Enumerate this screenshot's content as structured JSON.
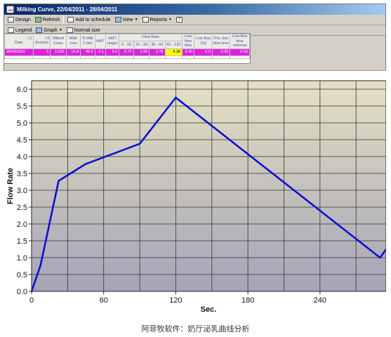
{
  "window": {
    "title": "Milking Curve, 22/04/2011 - 28/04/2011"
  },
  "toolbar": {
    "design": "Design",
    "refresh": "Refresh",
    "add_to_schedule": "Add to schedule",
    "view": "View",
    "reports": "Reports"
  },
  "toolbar2": {
    "legend": "Legend",
    "graph": "Graph",
    "normal_size": "Normal size"
  },
  "table": {
    "group_header": "Flow Rate",
    "columns": {
      "date": "Date",
      "session": "Session",
      "milked_cows": "Milked Cows",
      "milk_cow": "Milk/ cow",
      "pct_milk_2min": "% Milk 2 min",
      "amt": "AMT",
      "amt_target": "AMT target",
      "fr_0_15": "0 - 15",
      "fr_15_30": "15 - 30",
      "fr_30_60": "30 - 60",
      "fr_60_120": "60 - 120",
      "low_flow_time": "Low flow time",
      "low_flow_pct": "Low flow (%)",
      "pre_low_flow_time": "Pre. low flow time",
      "low_flow_time_removal": "Low flow time removal"
    },
    "sort_markers": {
      "date": "▽1",
      "session": "▽2"
    },
    "row": {
      "date": "25/04/2011",
      "session": "1",
      "milked_cows": "1,022",
      "milk_cow": "14.8",
      "pct_milk_2min": "49.3",
      "amt": "4.1",
      "amt_target": "5.6",
      "fr_0_15": "0.73",
      "fr_15_30": "3.28",
      "fr_30_60": "3.78",
      "fr_60_120": "4.38",
      "low_flow_time": "0.30",
      "low_flow_pct": "6.0",
      "pre_low_flow_time": "0.35",
      "low_flow_time_removal": "0.16"
    }
  },
  "chart_data": {
    "type": "line",
    "xlabel": "Sec.",
    "ylabel": "Flow Rate",
    "xlim": [
      0,
      295
    ],
    "ylim": [
      0,
      6.25
    ],
    "x_ticks": [
      0,
      60,
      120,
      180,
      240
    ],
    "y_ticks": [
      0.0,
      0.5,
      1.0,
      1.5,
      2.0,
      2.5,
      3.0,
      3.5,
      4.0,
      4.5,
      5.0,
      5.5,
      6.0
    ],
    "y_tick_labels": [
      "0.0",
      "0.5",
      "1.0",
      "1.5",
      "2.0",
      "2.5",
      "3.0",
      "3.5",
      "4.0",
      "4.5",
      "5.0",
      "5.5",
      "6.0"
    ],
    "grid": true,
    "series": [
      {
        "color": "#1010d0",
        "x": [
          0,
          7.5,
          22.5,
          45,
          90,
          120,
          290,
          295
        ],
        "y": [
          0.0,
          0.78,
          3.28,
          3.78,
          4.38,
          5.75,
          1.0,
          1.25
        ]
      }
    ]
  },
  "caption": "阿菲牧软件：奶厅泌乳曲线分析",
  "colors": {
    "line": "#1010d0",
    "plot_top": "#e4e1c2",
    "plot_bottom": "#a6a3b8",
    "selected_row": "#e020e0",
    "highlight_cell": "#ffff00"
  }
}
